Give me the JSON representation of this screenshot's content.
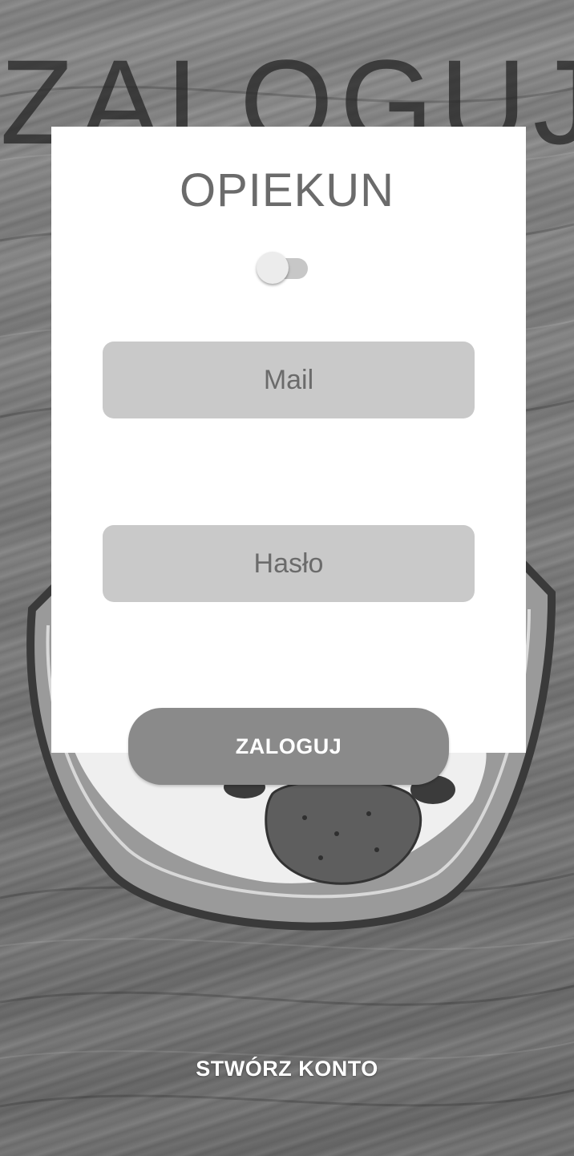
{
  "hero": {
    "title": "ZALOGUJ"
  },
  "card": {
    "role_title": "OPIEKUN",
    "role_switch": {
      "state": "off"
    },
    "mail_field": {
      "value": "",
      "placeholder": "Mail"
    },
    "password_field": {
      "value": "",
      "placeholder": "Hasło"
    },
    "login_button_label": "ZALOGUJ"
  },
  "footer": {
    "create_account_label": "STWÓRZ KONTO"
  },
  "colors": {
    "card_background": "#ffffff",
    "field_background": "#c9c9c9",
    "button_background": "#8a8a8a",
    "title_text": "#6b6b6b"
  },
  "icons": {
    "background_image": "wooden-table-yogurt-bowl-image"
  }
}
